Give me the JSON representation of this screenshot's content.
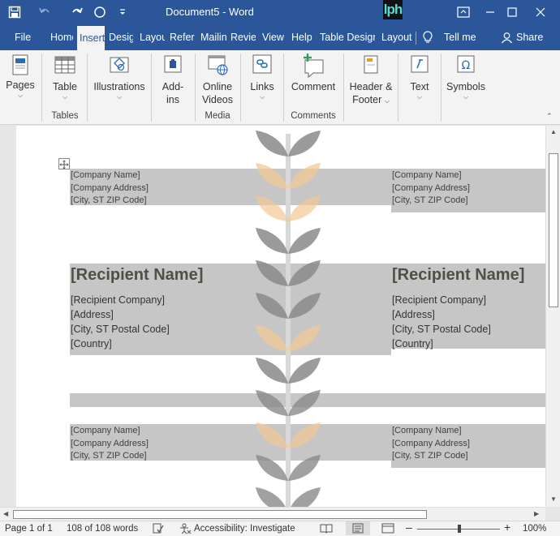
{
  "titlebar": {
    "title": "Document5  -  Word",
    "logo": "lph",
    "quick_access": [
      "save-icon",
      "undo-icon",
      "redo-icon",
      "circle-icon",
      "customize-icon"
    ],
    "window_controls": [
      "restore-ribbon-icon",
      "minimize-icon",
      "maximize-icon",
      "close-icon"
    ]
  },
  "menu": {
    "tabs": [
      "File",
      "Home",
      "Insert",
      "Design",
      "Layout",
      "References",
      "Mailings",
      "Review",
      "View",
      "Help",
      "Table Design",
      "Layout"
    ],
    "active": "Insert",
    "tell_me": "Tell me",
    "share": "Share"
  },
  "ribbon": {
    "pages": "Pages",
    "table": "Table",
    "illustrations": "Illustrations",
    "addins_1": "Add-",
    "addins_2": "ins",
    "online_1": "Online",
    "online_2": "Videos",
    "links": "Links",
    "comment": "Comment",
    "header_1": "Header &",
    "header_2": "Footer",
    "text": "Text",
    "symbols": "Symbols",
    "groups": {
      "tables": "Tables",
      "media": "Media",
      "comments": "Comments"
    }
  },
  "document": {
    "sender_left_1": {
      "name": "[Company Name]",
      "address": "[Company Address]",
      "city": "[City, ST  ZIP Code]"
    },
    "sender_right_1": {
      "name": "[Company Name]",
      "address": "[Company Address]",
      "city": "[City, ST  ZIP Code]"
    },
    "recipient_left": {
      "name": "[Recipient Name]",
      "company": "[Recipient Company]",
      "address": "[Address]",
      "city": "[City, ST  Postal Code]",
      "country": "[Country]"
    },
    "recipient_right": {
      "name": "[Recipient Name]",
      "company": "[Recipient Company]",
      "address": "[Address]",
      "city": "[City, ST  Postal Code]",
      "country": "[Country]"
    },
    "sender_left_2": {
      "name": "[Company Name]",
      "address": "[Company Address]",
      "city": "[City, ST  ZIP Code]"
    },
    "sender_right_2": {
      "name": "[Company Name]",
      "address": "[Company Address]",
      "city": "[City, ST  ZIP Code]"
    }
  },
  "status": {
    "page": "Page 1 of 1",
    "words": "108 of 108 words",
    "accessibility": "Accessibility: Investigate",
    "zoom": "100%"
  },
  "colors": {
    "brand": "#2b579a",
    "band": "#c6c6c6",
    "leaf_gray": "#8a8a8a",
    "leaf_tan": "#f2c994"
  }
}
